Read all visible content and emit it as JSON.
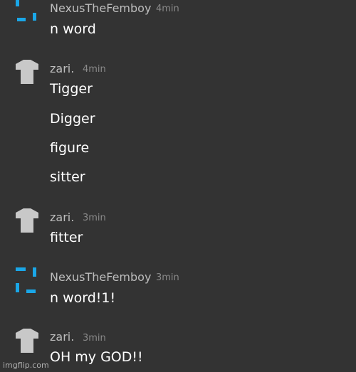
{
  "messages": [
    {
      "author": "NexusTheFemboy",
      "avatar_icon": "nexus-avatar-icon",
      "time": "4min",
      "lines": [
        "n word"
      ]
    },
    {
      "author": "zari.",
      "avatar_icon": "shirt-avatar-icon",
      "time": "4min",
      "lines": [
        "Tigger",
        "Digger",
        "figure",
        "sitter"
      ]
    },
    {
      "author": "zari.",
      "avatar_icon": "shirt-avatar-icon",
      "time": "3min",
      "lines": [
        "fitter"
      ]
    },
    {
      "author": "NexusTheFemboy",
      "avatar_icon": "nexus-avatar-icon",
      "time": "3min",
      "lines": [
        "n word!1!"
      ]
    },
    {
      "author": "zari.",
      "avatar_icon": "shirt-avatar-icon",
      "time": "3min",
      "lines": [
        "OH my GOD!!"
      ]
    }
  ],
  "watermark": "imgflip.com",
  "colors": {
    "background": "#333333",
    "nexus_avatar": "#1aa7e8",
    "shirt_avatar": "#c8c8c8"
  }
}
